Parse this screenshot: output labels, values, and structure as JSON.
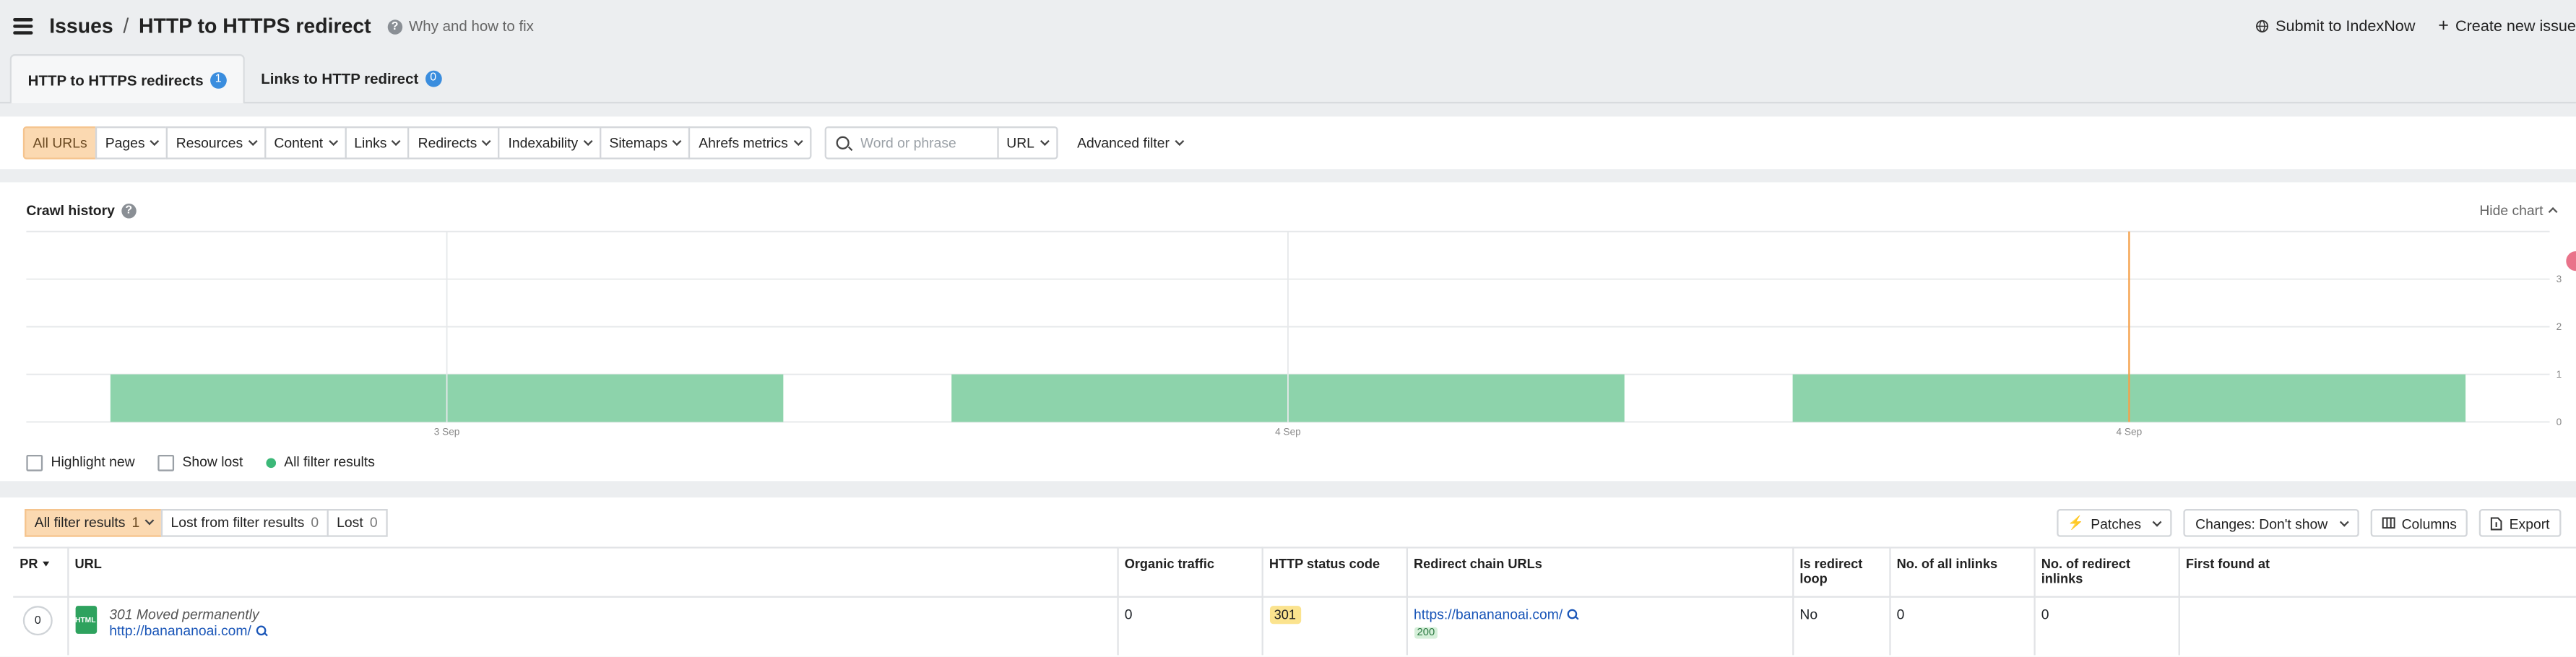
{
  "header": {
    "breadcrumb_root": "Issues",
    "breadcrumb_sep": "/",
    "title": "HTTP to HTTPS redirect",
    "help_link": "Why and how to fix",
    "submit_indexnow": "Submit to IndexNow",
    "create_issue": "Create new issue"
  },
  "tabs": [
    {
      "label": "HTTP to HTTPS redirects",
      "count": "1",
      "active": true
    },
    {
      "label": "Links to HTTP redirect",
      "count": "0",
      "active": false
    }
  ],
  "filters": {
    "items": [
      "All URLs",
      "Pages",
      "Resources",
      "Content",
      "Links",
      "Redirects",
      "Indexability",
      "Sitemaps",
      "Ahrefs metrics"
    ],
    "search_placeholder": "Word or phrase",
    "search_scope": "URL",
    "advanced": "Advanced filter"
  },
  "chart": {
    "title": "Crawl history",
    "hide_label": "Hide chart",
    "legend": {
      "highlight_new": "Highlight new",
      "show_lost": "Show lost",
      "all_filter_results": "All filter results"
    }
  },
  "chart_data": {
    "type": "bar",
    "categories": [
      "3 Sep",
      "4 Sep",
      "4 Sep"
    ],
    "series": [
      {
        "name": "All filter results",
        "values": [
          1,
          1,
          1
        ]
      }
    ],
    "y_ticks": [
      "0",
      "1",
      "2",
      "3"
    ],
    "ylim": [
      0,
      4
    ],
    "grid": true,
    "legend_position": "bottom-left",
    "colors": {
      "bar": "#8dd3ab",
      "marker": "#f5a04a"
    }
  },
  "results": {
    "segments": [
      {
        "label": "All filter results",
        "count": "1",
        "selected": true
      },
      {
        "label": "Lost from filter results",
        "count": "0",
        "selected": false
      },
      {
        "label": "Lost",
        "count": "0",
        "selected": false
      }
    ],
    "tools": {
      "patches": "Patches",
      "changes": "Changes: Don't show",
      "columns": "Columns",
      "export": "Export"
    },
    "columns": [
      "PR",
      "URL",
      "Organic traffic",
      "HTTP status code",
      "Redirect chain URLs",
      "Is redirect loop",
      "No. of all inlinks",
      "No. of redirect inlinks",
      "First found at"
    ],
    "rows": [
      {
        "pr": "0",
        "file_type": "HTML",
        "title": "301 Moved permanently",
        "url": "http://banananoai.com/",
        "organic_traffic": "0",
        "status_code": "301",
        "redirect_chain_url": "https://banananoai.com/",
        "redirect_chain_status": "200",
        "is_redirect_loop": "No",
        "all_inlinks": "0",
        "redirect_inlinks": "0",
        "first_found": ""
      }
    ]
  }
}
